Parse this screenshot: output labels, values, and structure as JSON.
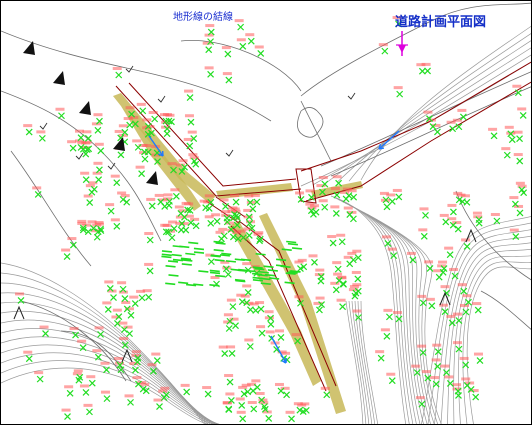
{
  "map": {
    "title": "道路計画平面図",
    "subtitle": "地形線の結線",
    "colors": {
      "contour": "#9a9a9a",
      "terrain_line": "#6e6e6e",
      "survey_point": "#22dd22",
      "point_label": "#ff5a5a",
      "road_edge": "#8b0000",
      "roadside_band": "#c8b858",
      "flow_arrow": "#1e78ff",
      "north_arrow": "#dd00dd",
      "text_blue": "#1a2fd0"
    },
    "icons": [
      "north-arrow-icon",
      "flow-arrow-icon",
      "survey-point-icon",
      "slope-mark-icon",
      "vegetation-icon"
    ]
  }
}
